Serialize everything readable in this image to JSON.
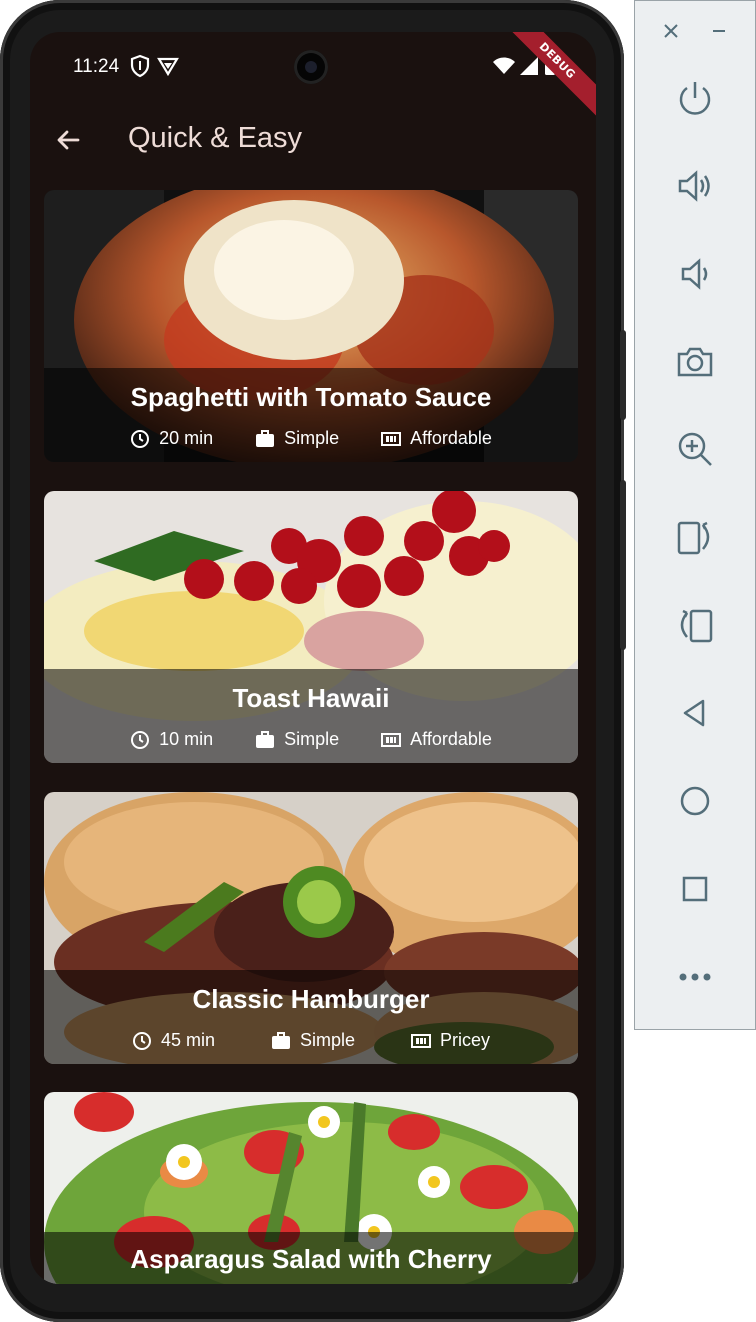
{
  "status_bar": {
    "time": "11:24",
    "icons": [
      "shield-icon",
      "vpn-icon",
      "wifi-icon",
      "signal-icon",
      "battery-icon"
    ]
  },
  "debug_banner": "DEBUG",
  "app_bar": {
    "title": "Quick & Easy",
    "back_icon": "arrow-back-icon"
  },
  "meals": [
    {
      "title": "Spaghetti with Tomato Sauce",
      "duration": "20 min",
      "complexity": "Simple",
      "affordability": "Affordable",
      "image": "spaghetti-photo"
    },
    {
      "title": "Toast Hawaii",
      "duration": "10 min",
      "complexity": "Simple",
      "affordability": "Affordable",
      "image": "toast-hawaii-photo"
    },
    {
      "title": "Classic Hamburger",
      "duration": "45 min",
      "complexity": "Simple",
      "affordability": "Pricey",
      "image": "hamburger-photo"
    },
    {
      "title": "Asparagus Salad with Cherry",
      "duration": "",
      "complexity": "",
      "affordability": "",
      "image": "asparagus-salad-photo"
    }
  ],
  "emulator_panel": {
    "buttons": [
      "close-icon",
      "minimize-icon",
      "power-icon",
      "volume-up-icon",
      "volume-down-icon",
      "camera-icon",
      "zoom-in-icon",
      "rotate-left-icon",
      "rotate-right-icon",
      "back-icon",
      "home-icon",
      "overview-icon",
      "more-icon"
    ]
  },
  "colors": {
    "background": "#1a110f",
    "title": "#eedcd7",
    "overlay": "rgba(0,0,0,0.55)",
    "debug": "#a41f2d",
    "panel": "#eceff1",
    "panel_icon": "#546e7a"
  }
}
